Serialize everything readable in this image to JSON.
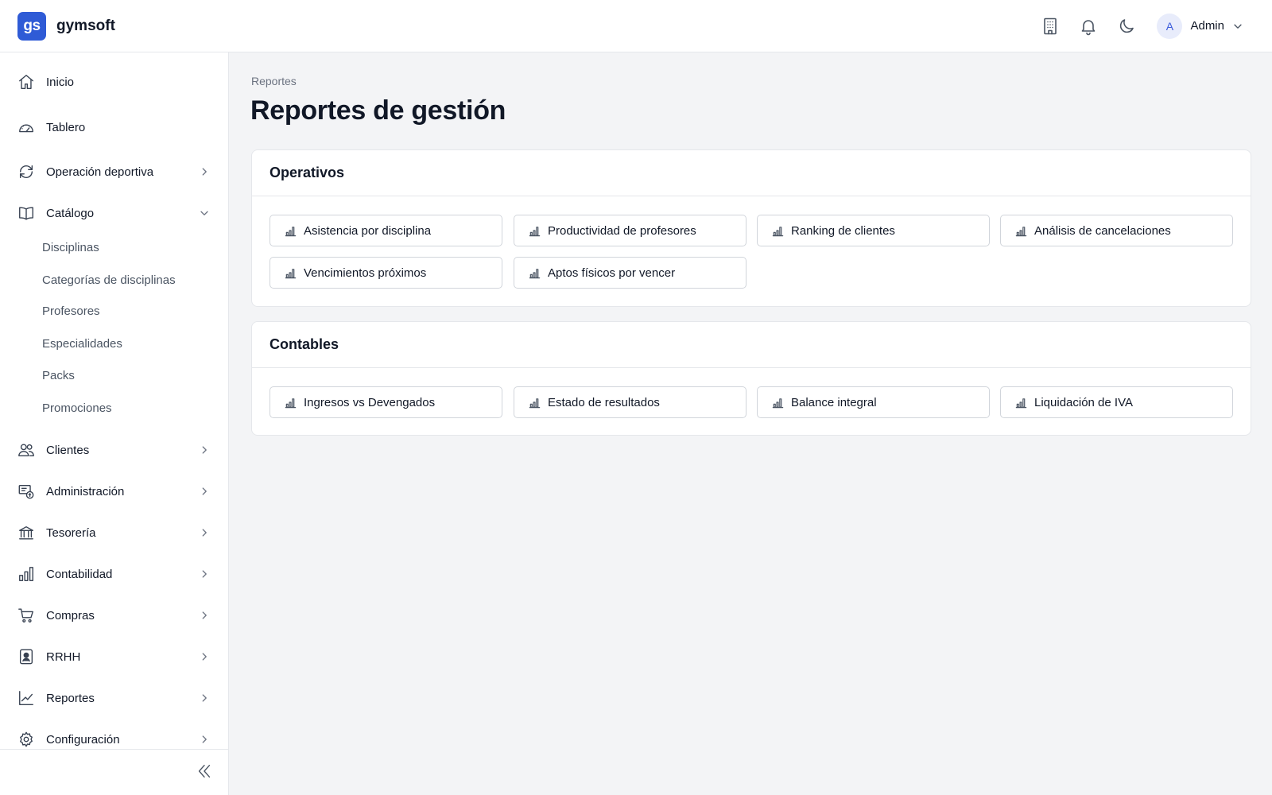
{
  "app": {
    "logo_text": "gs",
    "name": "gymsoft"
  },
  "header": {
    "icons": [
      "building-icon",
      "bell-icon",
      "moon-icon"
    ],
    "user": {
      "initial": "A",
      "name": "Admin"
    }
  },
  "sidebar": {
    "items": [
      {
        "label": "Inicio",
        "icon": "home-icon"
      },
      {
        "label": "Tablero",
        "icon": "gauge-icon"
      },
      {
        "label": "Operación deportiva",
        "icon": "refresh-icon"
      },
      {
        "label": "Catálogo",
        "icon": "book-icon",
        "expanded": true
      },
      {
        "label": "Clientes",
        "icon": "users-icon"
      },
      {
        "label": "Administración",
        "icon": "admin-icon"
      },
      {
        "label": "Tesorería",
        "icon": "bank-icon"
      },
      {
        "label": "Contabilidad",
        "icon": "bar-chart-icon"
      },
      {
        "label": "Compras",
        "icon": "cart-icon"
      },
      {
        "label": "RRHH",
        "icon": "badge-icon"
      },
      {
        "label": "Reportes",
        "icon": "line-chart-icon"
      },
      {
        "label": "Configuración",
        "icon": "gear-icon"
      }
    ],
    "catalog_sub": [
      "Disciplinas",
      "Categorías de disciplinas",
      "Profesores",
      "Especialidades",
      "Packs",
      "Promociones"
    ]
  },
  "main": {
    "breadcrumb": "Reportes",
    "title": "Reportes de gestión",
    "sections": [
      {
        "title": "Operativos",
        "reports": [
          "Asistencia por disciplina",
          "Productividad de profesores",
          "Ranking de clientes",
          "Análisis de cancelaciones",
          "Vencimientos próximos",
          "Aptos físicos por vencer"
        ]
      },
      {
        "title": "Contables",
        "reports": [
          "Ingresos vs Devengados",
          "Estado de resultados",
          "Balance integral",
          "Liquidación de IVA"
        ]
      }
    ]
  },
  "colors": {
    "brand": "#2f5bd6",
    "background": "#f3f4f6",
    "border": "#e5e7eb"
  }
}
